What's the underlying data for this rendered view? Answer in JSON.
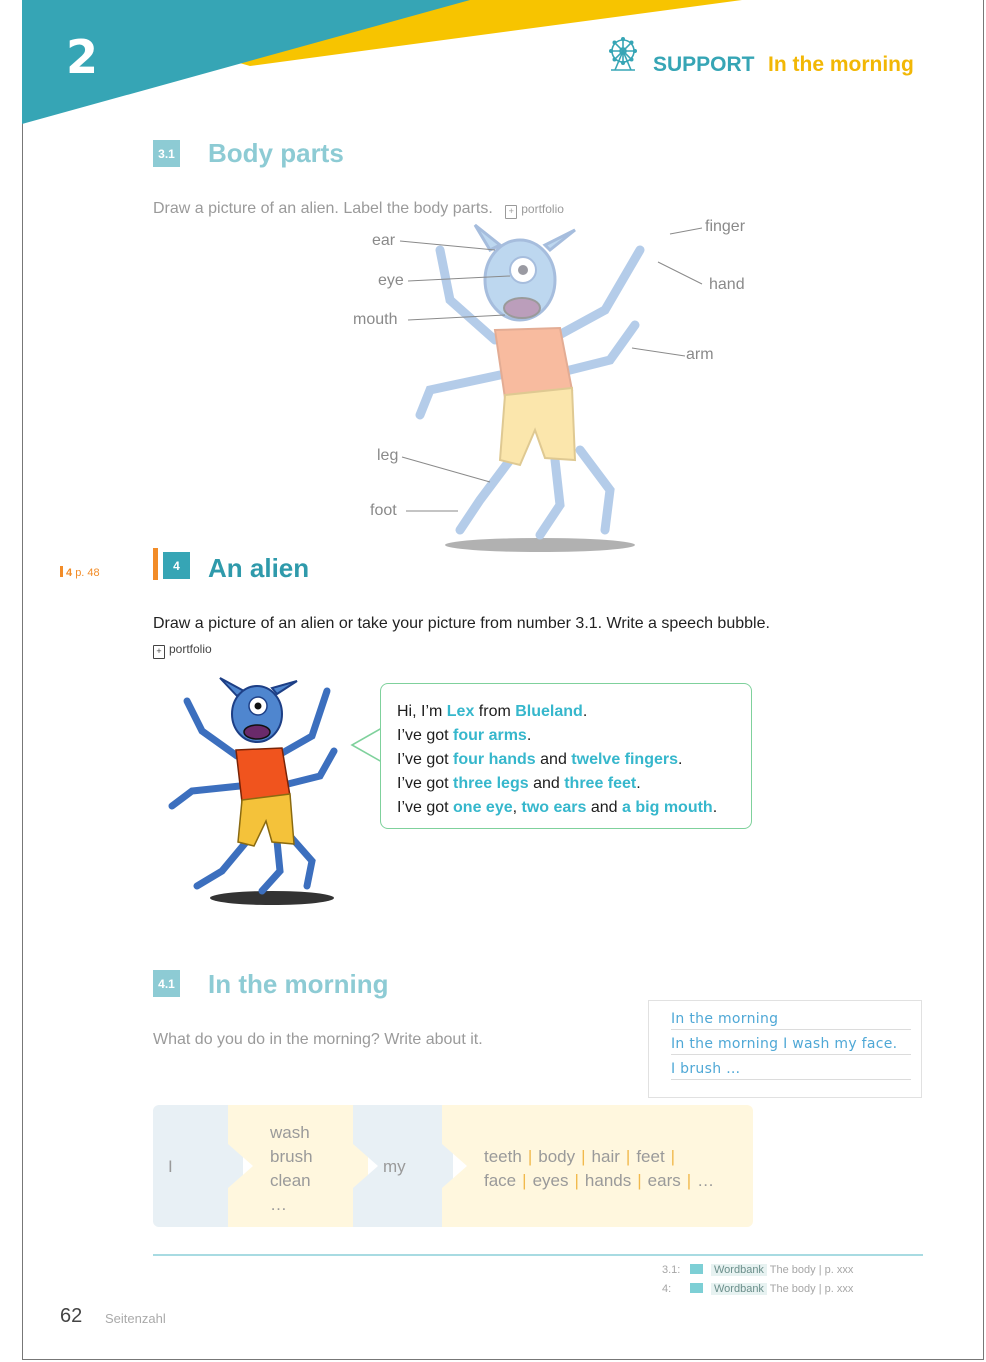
{
  "header": {
    "chapter_number": "2",
    "support_label": "SUPPORT",
    "support_title": "In the morning",
    "icon": "ferris-wheel-icon",
    "colors": {
      "teal": "#36a5b5",
      "yellow": "#f2b705"
    }
  },
  "section_3_1": {
    "badge": "3.1",
    "title": "Body parts",
    "instruction": "Draw a picture of an alien. Label the body parts.",
    "portfolio": "portfolio",
    "labels": {
      "ear": "ear",
      "eye": "eye",
      "mouth": "mouth",
      "leg": "leg",
      "foot": "foot",
      "finger": "finger",
      "hand": "hand",
      "arm": "arm"
    }
  },
  "section_4": {
    "side_ref_num": "4",
    "side_ref_page": "p. 48",
    "badge": "4",
    "title": "An alien",
    "instruction": "Draw a picture of an alien or take your picture from number 3.1. Write a speech bubble.",
    "portfolio": "portfolio",
    "bubble": {
      "l1": {
        "a": "Hi, I’m ",
        "b": "Lex",
        "c": " from ",
        "d": "Blueland",
        "e": "."
      },
      "l2": {
        "a": "I’ve got ",
        "b": "four arms",
        "c": "."
      },
      "l3": {
        "a": "I’ve got ",
        "b": "four hands",
        "c": " and ",
        "d": "twelve fingers",
        "e": "."
      },
      "l4": {
        "a": "I’ve got ",
        "b": "three legs",
        "c": " and ",
        "d": "three feet",
        "e": "."
      },
      "l5": {
        "a": "I’ve got ",
        "b": "one eye",
        "c": ", ",
        "d": "two ears",
        "e": " and ",
        "f": "a big mouth",
        "g": "."
      }
    }
  },
  "section_4_1": {
    "badge": "4.1",
    "title": "In the morning",
    "instruction": "What do you do in the morning? Write about it.",
    "example_lines": [
      "In the morning",
      "In the morning I wash my face.",
      "I brush …"
    ],
    "table": {
      "col1": "I",
      "col2": [
        "wash",
        "brush",
        "clean",
        "…"
      ],
      "col3": "my",
      "col4_row1": [
        "teeth",
        "body",
        "hair",
        "feet"
      ],
      "col4_row2": [
        "face",
        "eyes",
        "hands",
        "ears",
        "…"
      ]
    }
  },
  "footer": {
    "refs": [
      {
        "prefix": "3.1:",
        "wordbank": "Wordbank",
        "text": "The body | p. xxx"
      },
      {
        "prefix": "4:",
        "wordbank": "Wordbank",
        "text": "The body | p. xxx"
      }
    ],
    "page_number": "62",
    "seitenzahl": "Seitenzahl"
  }
}
